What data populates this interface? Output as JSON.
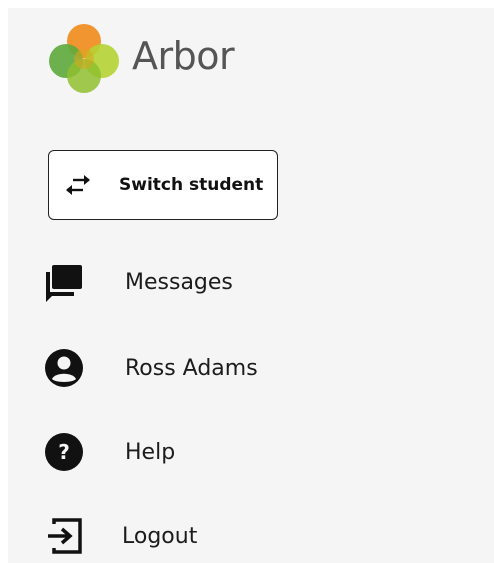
{
  "brand": {
    "name": "Arbor",
    "colors": {
      "orange": "#f08c1e",
      "green": "#5daa3c",
      "lime": "#b5d334",
      "olive": "#8fbf2f"
    }
  },
  "switch_student": {
    "label": "Switch student",
    "icon": "swap-arrows-icon"
  },
  "menu": [
    {
      "id": "messages",
      "label": "Messages",
      "icon": "chat-icon"
    },
    {
      "id": "profile",
      "label": "Ross Adams",
      "icon": "account-circle-icon"
    },
    {
      "id": "help",
      "label": "Help",
      "icon": "help-circle-icon"
    },
    {
      "id": "logout",
      "label": "Logout",
      "icon": "logout-icon"
    }
  ]
}
